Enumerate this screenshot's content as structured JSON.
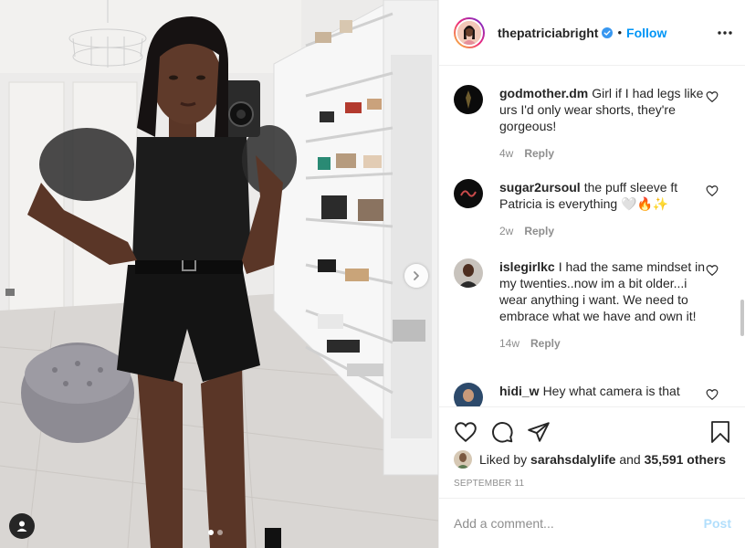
{
  "post": {
    "carousel": {
      "slide_count": 2,
      "active_slide": 1
    }
  },
  "header": {
    "username": "thepatriciabright",
    "separator": "•",
    "follow_label": "Follow",
    "more_icon": "more-horizontal-icon"
  },
  "comments": [
    {
      "username": "godmother.dm",
      "text": "Girl if I had legs like urs I'd only wear shorts, they're gorgeous!",
      "time": "4w",
      "reply_label": "Reply"
    },
    {
      "username": "sugar2ursoul",
      "text": "the puff sleeve ft Patricia is everything 🤍🔥✨",
      "time": "2w",
      "reply_label": "Reply"
    },
    {
      "username": "islegirlkc",
      "text": "I had the same mindset in my twenties..now im a bit older...i wear anything i want. We need to embrace what we have and own it!",
      "time": "14w",
      "reply_label": "Reply"
    },
    {
      "username": "hidi_w",
      "text": "Hey what camera is that",
      "time": "",
      "reply_label": ""
    }
  ],
  "likes": {
    "prefix": "Liked by",
    "user": "sarahsdalylife",
    "middle": "and",
    "others": "35,591 others"
  },
  "date": "SEPTEMBER 11",
  "add_comment": {
    "placeholder": "Add a comment...",
    "post_label": "Post"
  },
  "colors": {
    "link": "#0095f6",
    "post_disabled": "#b2dffc",
    "muted": "#8e8e8e"
  }
}
